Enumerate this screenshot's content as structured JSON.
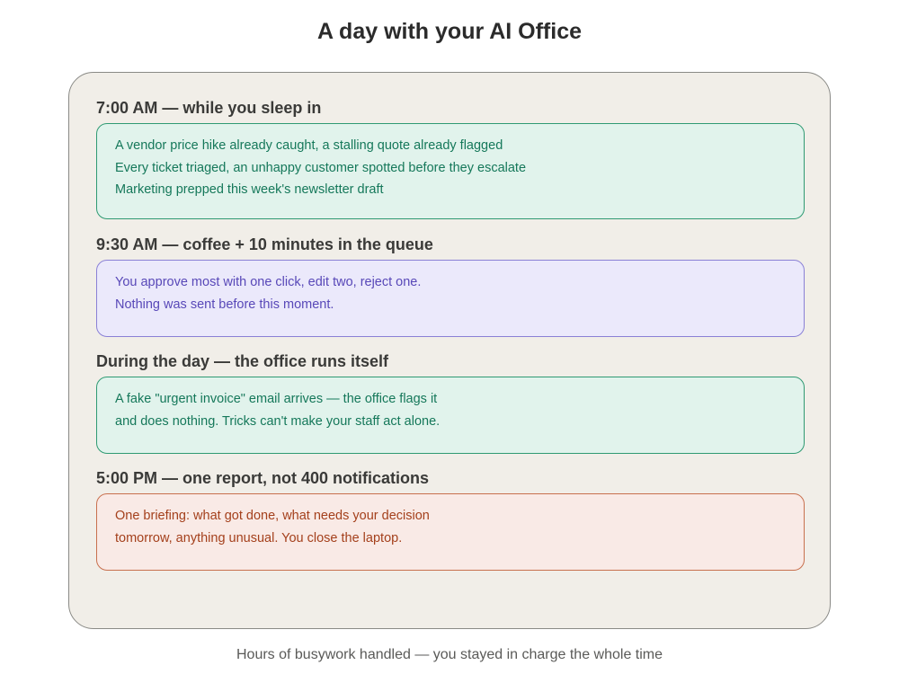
{
  "title": "A day with your AI Office",
  "sections": [
    {
      "heading": "7:00 AM — while you sleep in",
      "lines": [
        "A vendor price hike already caught, a stalling quote already flagged",
        "Every ticket triaged, an unhappy customer spotted before they escalate",
        "Marketing prepped this week's newsletter draft"
      ],
      "color": "#15785a"
    },
    {
      "heading": "9:30 AM — coffee + 10 minutes in the queue",
      "lines": [
        "You approve most with one click, edit two, reject one.",
        "Nothing was sent before this moment."
      ],
      "color": "#5848b8"
    },
    {
      "heading": "During the day — the office runs itself",
      "lines": [
        "A fake \"urgent invoice\" email arrives — the office flags it",
        "and does nothing. Tricks can't make your staff act alone."
      ],
      "color": "#15785a"
    },
    {
      "heading": "5:00 PM — one report, not 400 notifications",
      "lines": [
        "One briefing: what got done, what needs your decision",
        "tomorrow, anything unusual. You close the laptop."
      ],
      "color": "#a4401c"
    }
  ],
  "footer": "Hours of busywork handled — you stayed in charge the whole time"
}
